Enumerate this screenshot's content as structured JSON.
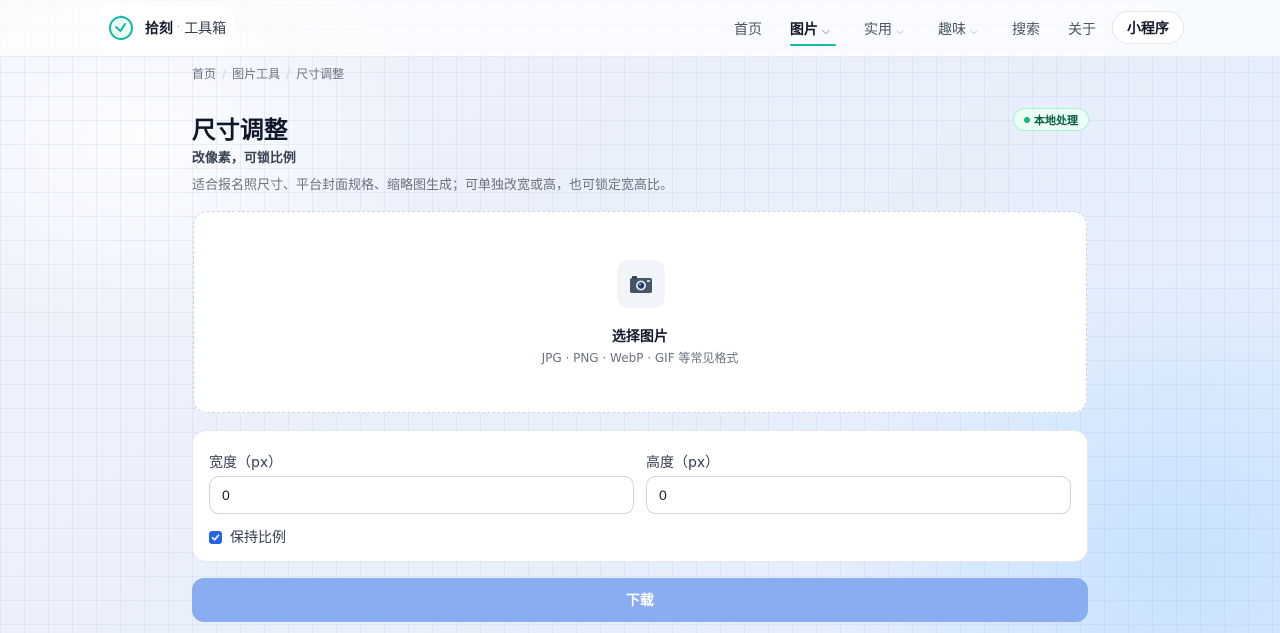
{
  "header": {
    "brand_name": "拾刻",
    "brand_sep": "·",
    "brand_sub": "工具箱",
    "nav": [
      {
        "label": "首页"
      },
      {
        "label": "图片",
        "active": true,
        "dropdown": true
      },
      {
        "label": "实用",
        "dropdown": true
      },
      {
        "label": "趣味",
        "dropdown": true
      },
      {
        "label": "搜索"
      },
      {
        "label": "关于"
      }
    ],
    "mini_program_label": "小程序",
    "accent_color": "#14b8a6"
  },
  "breadcrumb": [
    "首页",
    "图片工具",
    "尺寸调整"
  ],
  "page": {
    "title": "尺寸调整",
    "subtitle": "改像素，可锁比例",
    "description": "适合报名照尺寸、平台封面规格、缩略图生成；可单独改宽或高，也可锁定宽高比。",
    "badge": "本地处理"
  },
  "upload": {
    "icon": "camera-icon",
    "title": "选择图片",
    "hint": "JPG · PNG · WebP · GIF 等常见格式"
  },
  "size_form": {
    "width_label": "宽度（px）",
    "width_value": "0",
    "height_label": "高度（px）",
    "height_value": "0",
    "lock_ratio_label": "保持比例",
    "lock_ratio_checked": true
  },
  "download_label": "下载",
  "colors": {
    "primary_disabled": "#8aacf1",
    "checkbox": "#2563eb",
    "badge_green": "#10b981"
  }
}
